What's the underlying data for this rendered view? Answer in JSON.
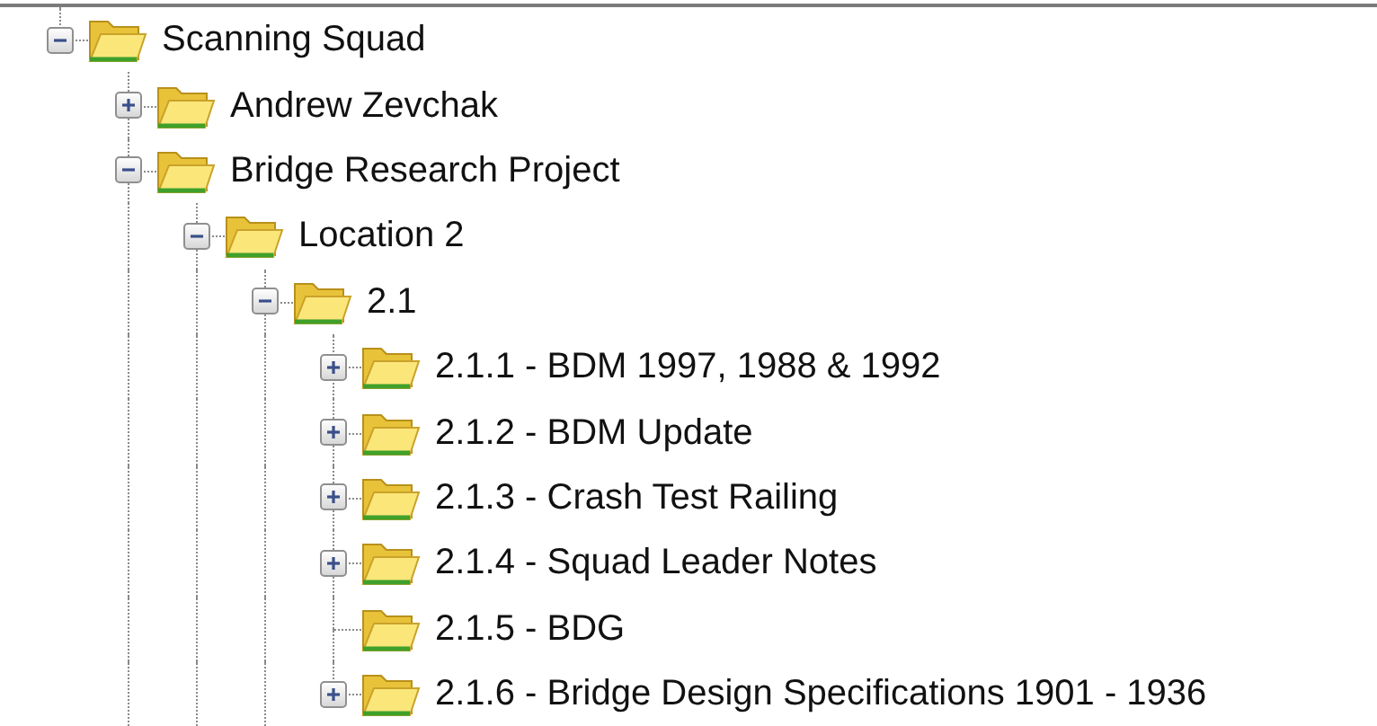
{
  "tree": [
    {
      "label": "Scanning Squad",
      "expanded": true,
      "has_children": true,
      "children": [
        {
          "label": "Andrew Zevchak",
          "expanded": false,
          "has_children": true
        },
        {
          "label": "Bridge Research Project",
          "expanded": true,
          "has_children": true,
          "children": [
            {
              "label": "Location 2",
              "expanded": true,
              "has_children": true,
              "children": [
                {
                  "label": "2.1",
                  "expanded": true,
                  "has_children": true,
                  "children": [
                    {
                      "label": "2.1.1 - BDM 1997, 1988 & 1992",
                      "expanded": false,
                      "has_children": true
                    },
                    {
                      "label": "2.1.2 - BDM Update",
                      "expanded": false,
                      "has_children": true
                    },
                    {
                      "label": "2.1.3 - Crash Test Railing",
                      "expanded": false,
                      "has_children": true
                    },
                    {
                      "label": "2.1.4 - Squad Leader Notes",
                      "expanded": false,
                      "has_children": true
                    },
                    {
                      "label": "2.1.5 - BDG",
                      "has_children": false
                    },
                    {
                      "label": "2.1.6 - Bridge Design Specifications 1901 - 1936",
                      "expanded": false,
                      "has_children": true
                    }
                  ]
                }
              ]
            }
          ]
        }
      ]
    }
  ]
}
